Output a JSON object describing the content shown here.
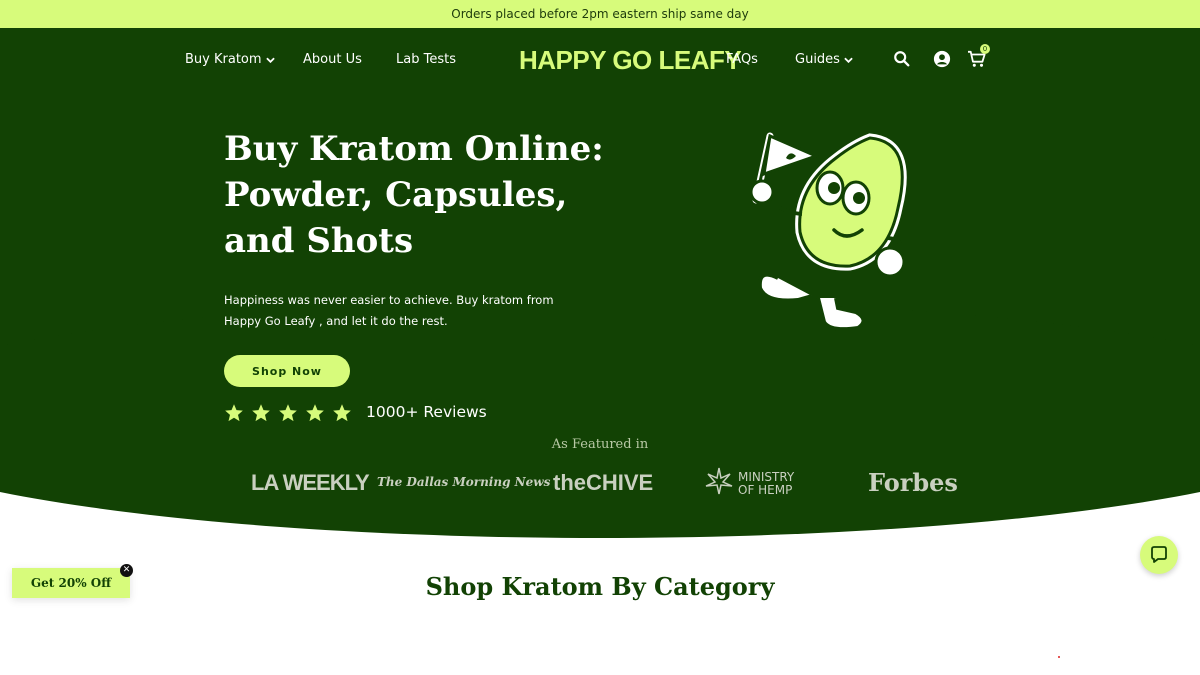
{
  "announcement": "Orders placed before 2pm eastern ship same day",
  "nav": {
    "buy_kratom": "Buy Kratom",
    "about_us": "About Us",
    "lab_tests": "Lab Tests",
    "logo": "HAPPY GO LEAFY",
    "faqs": "FAQs",
    "guides": "Guides",
    "cart_count": "0"
  },
  "hero": {
    "title": "Buy Kratom Online: Powder, Capsules, and Shots",
    "subtitle": "Happiness was never easier to achieve. Buy kratom from Happy Go Leafy , and let it do the rest.",
    "cta": "Shop Now",
    "rating_stars": 5,
    "reviews": "1000+  Reviews"
  },
  "featured": {
    "label": "As Featured in",
    "outlets": [
      "LA WEEKLY",
      "The Dallas Morning News",
      "theCHIVE",
      "MINISTRY OF HEMP",
      "Forbes"
    ]
  },
  "category_title": "Shop Kratom By Category",
  "promo": {
    "label": "Get 20% Off",
    "close": "✕"
  },
  "colors": {
    "brand_green": "#124204",
    "accent_lime": "#d7fb7b"
  },
  "icons": [
    "chevron-down-icon",
    "search-icon",
    "account-icon",
    "cart-icon",
    "star-icon",
    "chat-icon",
    "close-icon"
  ]
}
